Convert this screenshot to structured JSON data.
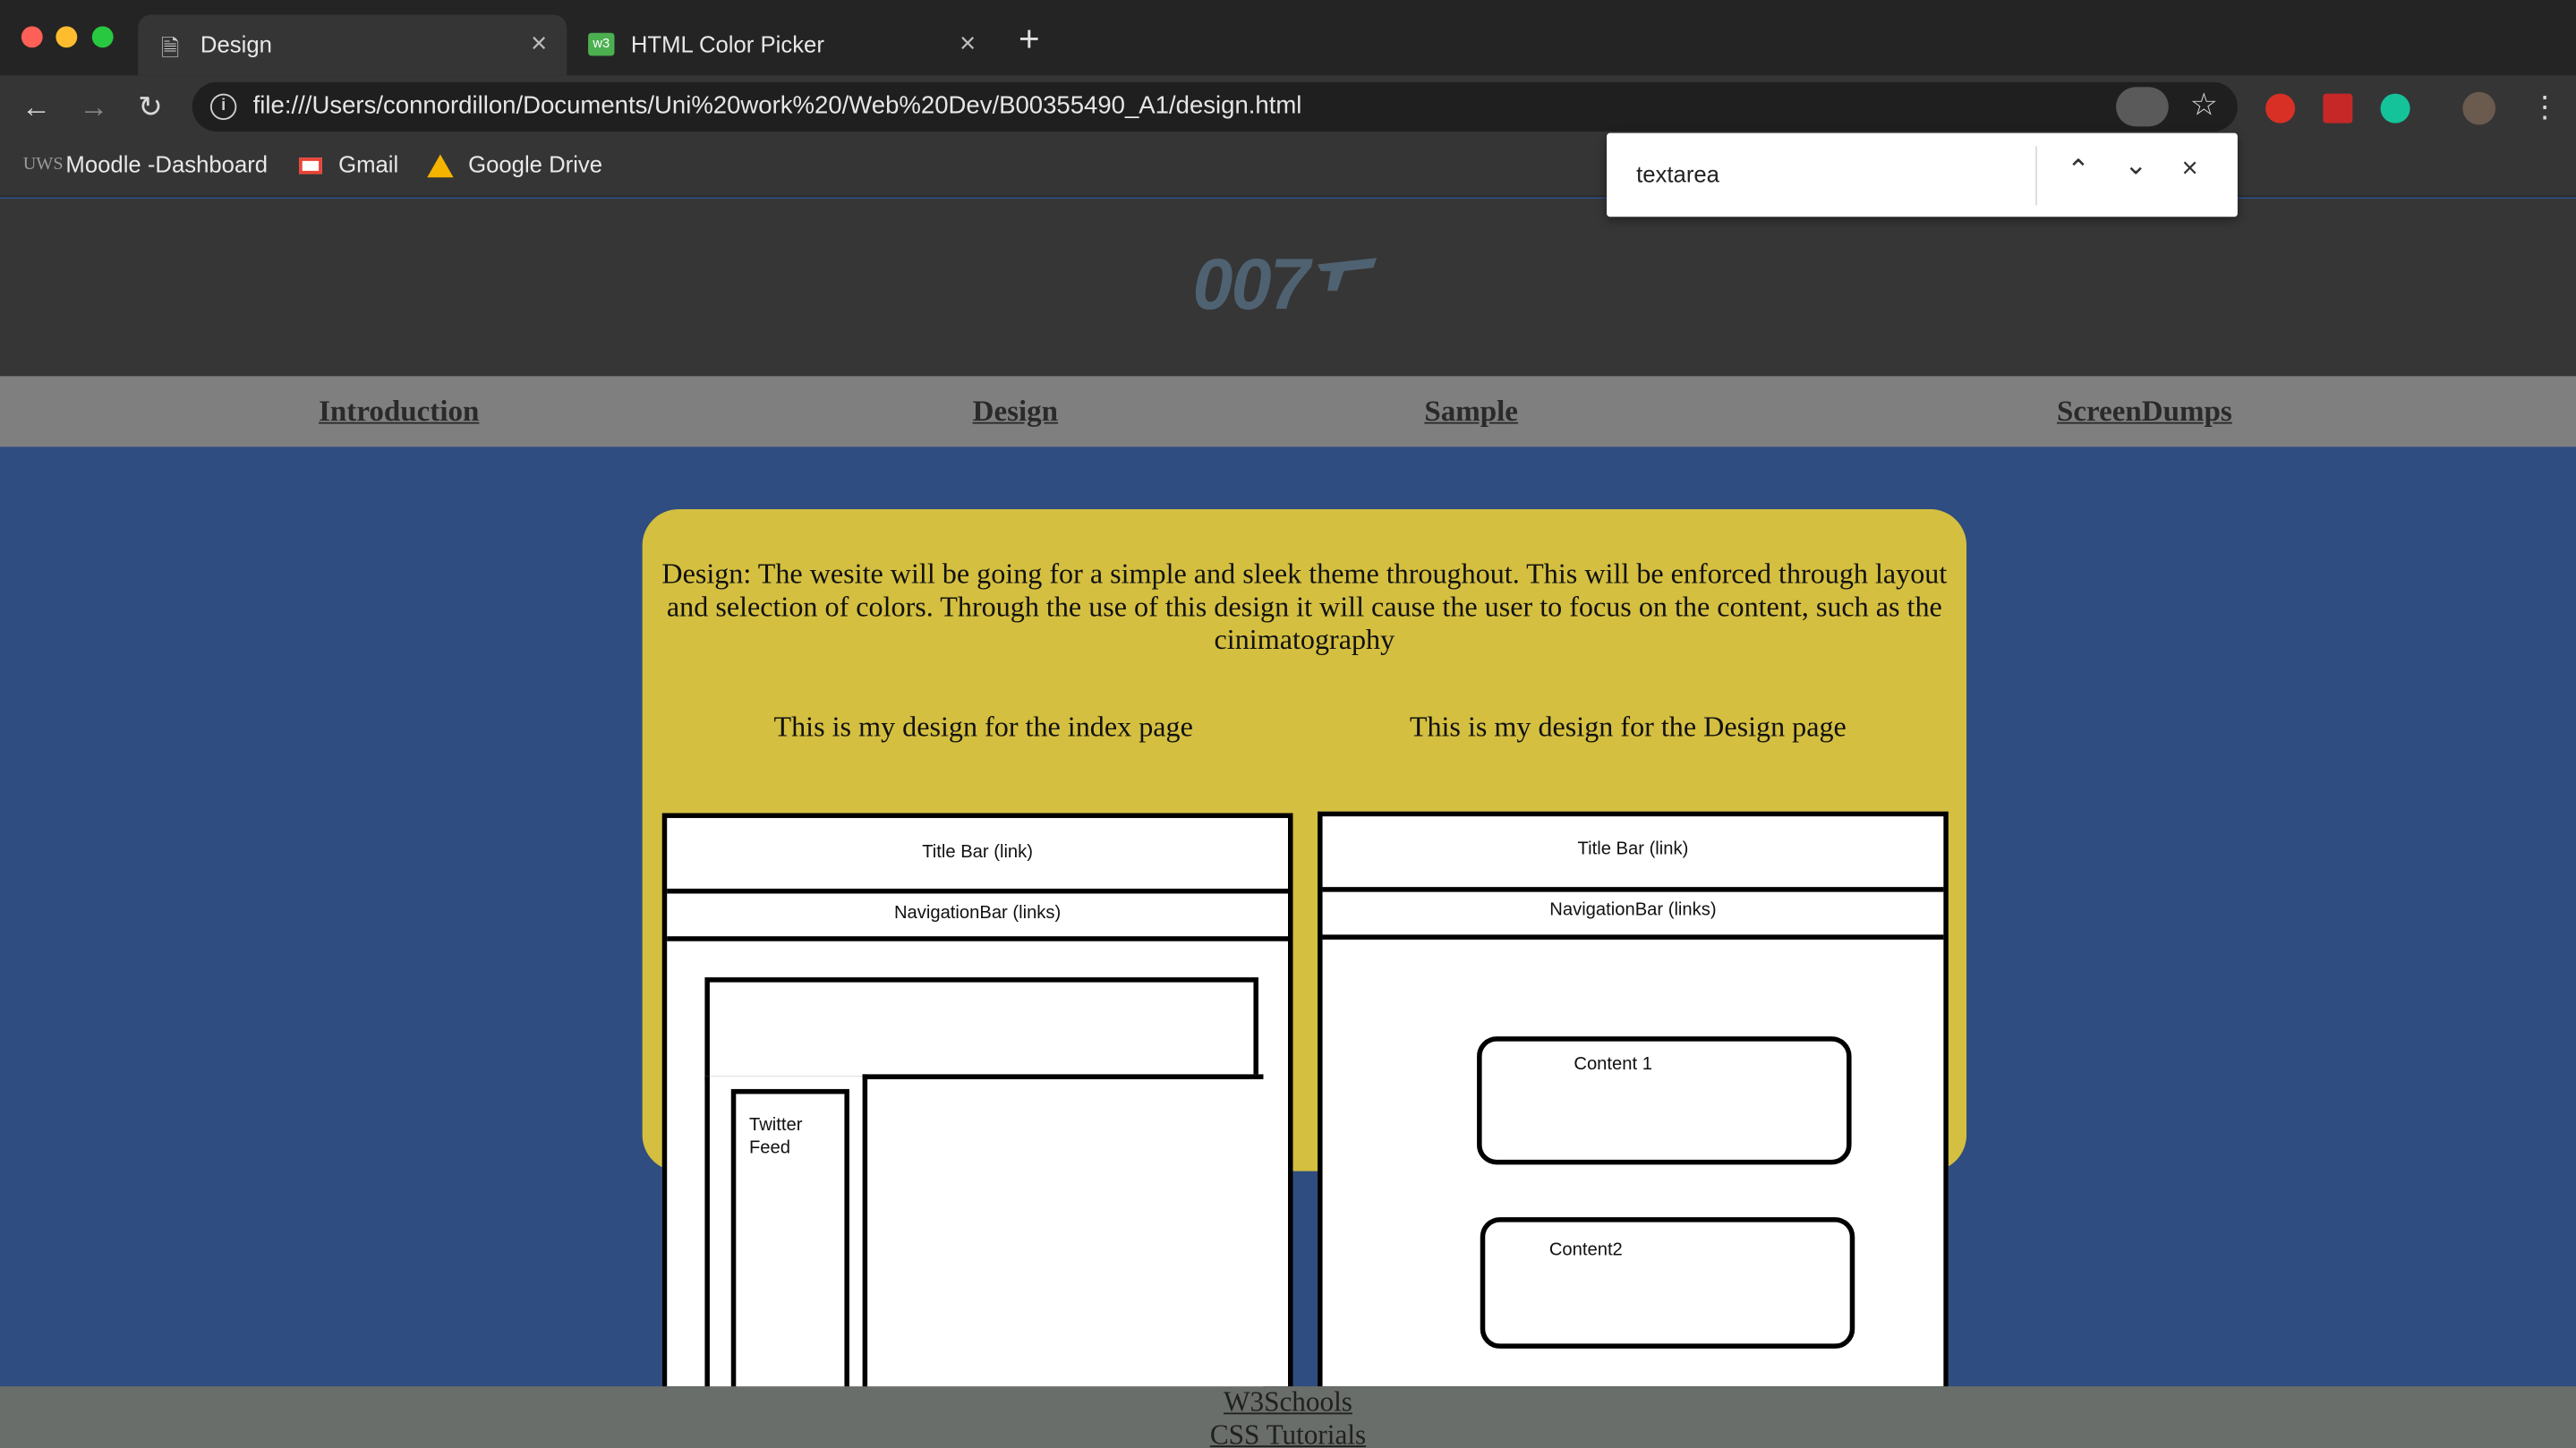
{
  "browser": {
    "tabs": [
      {
        "title": "Design",
        "active": true
      },
      {
        "title": "HTML Color Picker",
        "active": false
      }
    ],
    "new_tab": "+",
    "url": "file:///Users/connordillon/Documents/Uni%20work%20/Web%20Dev/B00355490_A1/design.html",
    "bookmarks": [
      "Moodle -Dashboard",
      "Gmail",
      "Google Drive"
    ],
    "find": {
      "query": "textarea"
    }
  },
  "page": {
    "logo": "007",
    "nav": [
      "Introduction",
      "Design",
      "Sample",
      "ScreenDumps"
    ],
    "intro": "Design: The wesite will be going for a simple and sleek theme throughout. This will be enforced through layout and selection of colors. Through the use of this design it will cause the user to focus on the content, such as the cinimatography",
    "captions": [
      "This is my design for the index page",
      "This is my design for the Design page"
    ],
    "wireframe_index": {
      "title_bar": "Title Bar (link)",
      "nav_bar": "NavigationBar (links)",
      "twitter": "Twitter Feed"
    },
    "wireframe_design": {
      "title_bar": "Title Bar (link)",
      "nav_bar": "NavigationBar (links)",
      "content1": "Content 1",
      "content2": "Content2"
    },
    "footer_links": [
      "W3Schools",
      "CSS Tutorials"
    ]
  },
  "colors": {
    "page_bg": "#2f4d80",
    "card": "#d4bf40",
    "nav": "#7f7f7f",
    "header": "#363636",
    "footer": "#6a6e6a"
  }
}
